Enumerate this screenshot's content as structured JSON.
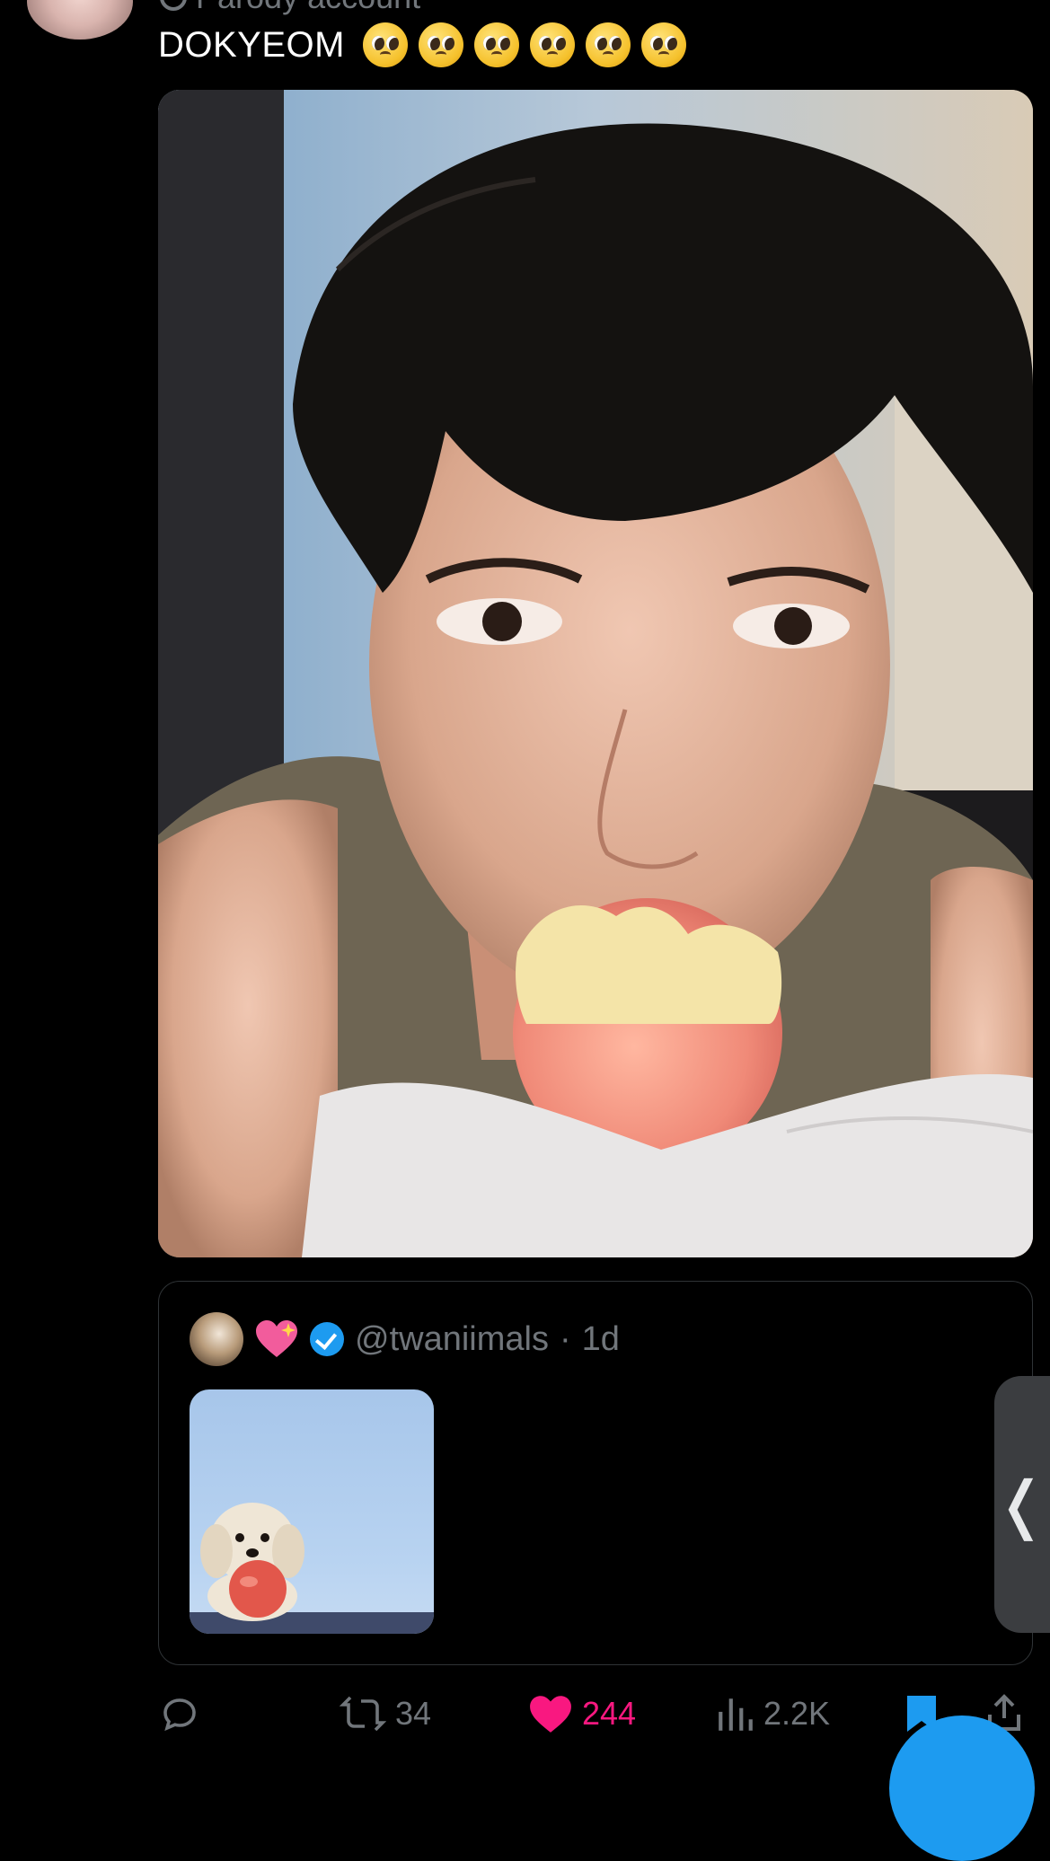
{
  "post": {
    "label": "Parody account",
    "text": "DOKYEOM",
    "emojis": [
      "pleading-face",
      "pleading-face",
      "pleading-face",
      "pleading-face",
      "pleading-face",
      "pleading-face"
    ]
  },
  "quote": {
    "handle": "@twaniimals",
    "separator": "·",
    "time": "1d"
  },
  "actions": {
    "reply_count": "",
    "retweet_count": "34",
    "like_count": "244",
    "views_count": "2.2K"
  },
  "side_tab": {
    "glyph": "❬"
  },
  "colors": {
    "background": "#000000",
    "secondary_text": "#71767b",
    "like": "#f91880",
    "accent": "#1d9bf0"
  }
}
